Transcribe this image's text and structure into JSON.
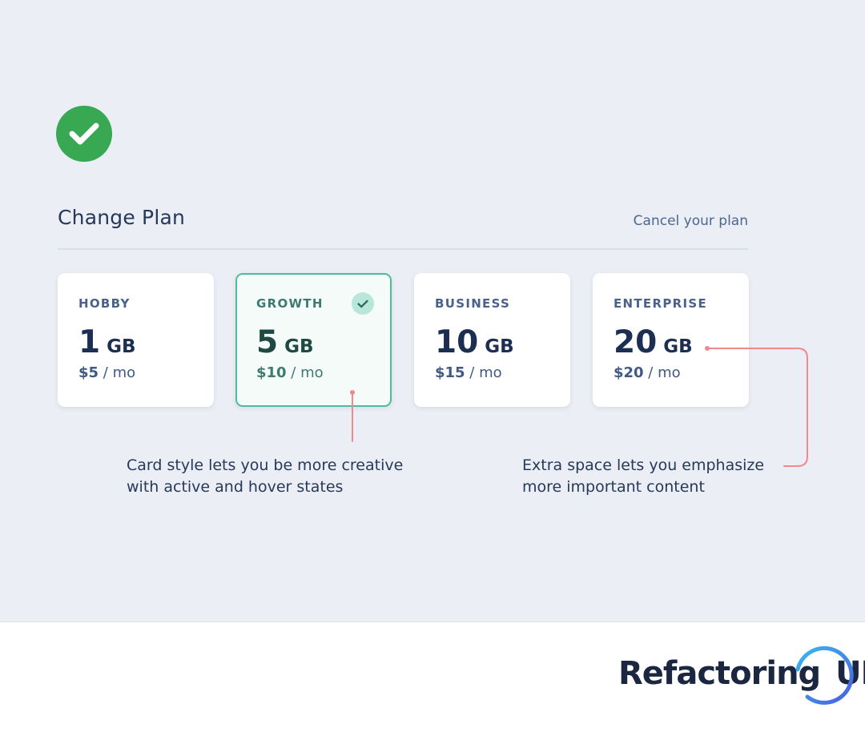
{
  "page": {
    "title": "Change Plan",
    "cancel_label": "Cancel your plan"
  },
  "plans": [
    {
      "name": "HOBBY",
      "size": "1",
      "unit": "GB",
      "price": "$5",
      "period": " / mo",
      "selected": false
    },
    {
      "name": "GROWTH",
      "size": "5",
      "unit": "GB",
      "price": "$10",
      "period": " / mo",
      "selected": true
    },
    {
      "name": "BUSINESS",
      "size": "10",
      "unit": "GB",
      "price": "$15",
      "period": " / mo",
      "selected": false
    },
    {
      "name": "ENTERPRISE",
      "size": "20",
      "unit": "GB",
      "price": "$20",
      "period": " / mo",
      "selected": false
    }
  ],
  "annotations": {
    "card_style": [
      "Card style lets you be more creative",
      "with active and hover states"
    ],
    "extra_space": [
      "Extra space lets you emphasize",
      "more important content"
    ]
  },
  "brand": {
    "name": "Refactoring",
    "suffix": "UI"
  },
  "icons": {
    "success": "check-circle-icon",
    "selected": "check-icon"
  },
  "colors": {
    "success": "#38a852",
    "active_border": "#4dbb9e",
    "annotation_line": "#ef8a8a",
    "background": "#ebeef4"
  }
}
